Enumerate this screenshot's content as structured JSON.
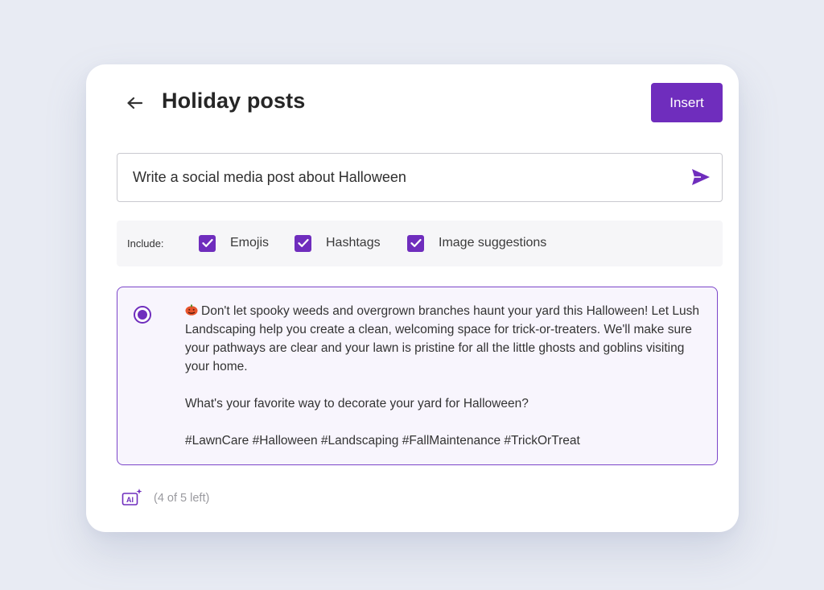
{
  "header": {
    "title": "Holiday posts",
    "insert_label": "Insert",
    "back_icon": "arrow-left-icon"
  },
  "prompt": {
    "value": "Write a social media post about Halloween",
    "send_icon": "send-icon"
  },
  "include": {
    "label": "Include:",
    "options": [
      {
        "label": "Emojis",
        "checked": true
      },
      {
        "label": "Hashtags",
        "checked": true
      },
      {
        "label": "Image suggestions",
        "checked": true
      }
    ]
  },
  "result": {
    "selected": true,
    "emoji_icon": "jack-o-lantern-icon",
    "paragraphs": [
      "Don't let spooky weeds and overgrown branches haunt your yard this Halloween! Let Lush Landscaping help you create a clean, welcoming space for trick-or-treaters. We'll make sure your pathways are clear and your lawn is pristine for all the little ghosts and goblins visiting your home.",
      "What's your favorite way to decorate your yard for Halloween?",
      "#LawnCare #Halloween #Landscaping #FallMaintenance #TrickOrTreat"
    ]
  },
  "footer": {
    "ai_icon": "ai-sparkle-icon",
    "remaining": "(4 of 5 left)"
  },
  "colors": {
    "accent": "#6f2dbd",
    "page_background": "#e8ebf3",
    "result_background": "#f8f5fd"
  }
}
